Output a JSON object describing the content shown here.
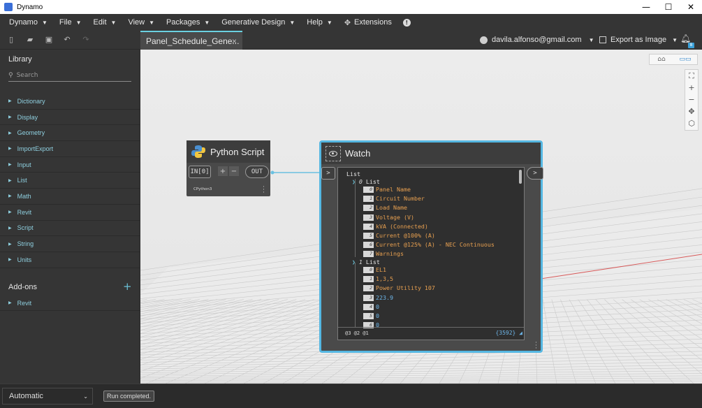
{
  "window": {
    "title": "Dynamo",
    "minimize": "—",
    "maximize": "☐",
    "close": "✕"
  },
  "menu": {
    "items": [
      {
        "label": "Dynamo"
      },
      {
        "label": "File"
      },
      {
        "label": "Edit"
      },
      {
        "label": "View"
      },
      {
        "label": "Packages"
      },
      {
        "label": "Generative Design"
      },
      {
        "label": "Help"
      }
    ],
    "extensions": "Extensions"
  },
  "toolbar": {
    "tab_label": "Panel_Schedule_Gene...",
    "tab_close": "×",
    "user": "davila.alfonso@gmail.com",
    "export": "Export as Image",
    "notification_count": "8"
  },
  "library": {
    "title": "Library",
    "search_placeholder": "Search",
    "categories": [
      "Dictionary",
      "Display",
      "Geometry",
      "ImportExport",
      "Input",
      "List",
      "Math",
      "Revit",
      "Script",
      "String",
      "Units"
    ],
    "addons_title": "Add-ons",
    "addons_plus": "+",
    "addons": [
      "Revit"
    ]
  },
  "canvas": {
    "view_toggle": [
      "3D",
      "graph"
    ]
  },
  "python_node": {
    "title": "Python Script",
    "input": "IN[0]",
    "output": "OUT",
    "plus": "+",
    "minus": "−",
    "engine": "CPython3"
  },
  "watch_node": {
    "title": "Watch",
    "in_port": ">",
    "out_port": ">",
    "root": "List",
    "list0_label": "List",
    "list0_index": "0",
    "list0": [
      {
        "i": "0",
        "v": "Panel Name"
      },
      {
        "i": "1",
        "v": "Circuit Number"
      },
      {
        "i": "2",
        "v": "Load Name"
      },
      {
        "i": "3",
        "v": "Voltage (V)"
      },
      {
        "i": "4",
        "v": "kVA (Connected)"
      },
      {
        "i": "5",
        "v": "Current @100% (A)"
      },
      {
        "i": "6",
        "v": "Current @125% (A) - NEC Continuous"
      },
      {
        "i": "7",
        "v": "Warnings"
      }
    ],
    "list1_label": "List",
    "list1_index": "1",
    "list1": [
      {
        "i": "0",
        "v": "EL1",
        "t": "str"
      },
      {
        "i": "1",
        "v": "1,3,5",
        "t": "str"
      },
      {
        "i": "2",
        "v": "Power Utility 107",
        "t": "str"
      },
      {
        "i": "3",
        "v": "223.9",
        "t": "num"
      },
      {
        "i": "4",
        "v": "0",
        "t": "num"
      },
      {
        "i": "5",
        "v": "0",
        "t": "num"
      },
      {
        "i": "6",
        "v": "0",
        "t": "num"
      }
    ],
    "levels": "@3 @2 @1",
    "count": "{3592}"
  },
  "statusbar": {
    "run_mode": "Automatic",
    "status": "Run completed."
  },
  "colors": {
    "accent": "#55b7e2",
    "string_value": "#e8a050",
    "number_value": "#6db5e8",
    "library_link": "#8fd0e0"
  }
}
